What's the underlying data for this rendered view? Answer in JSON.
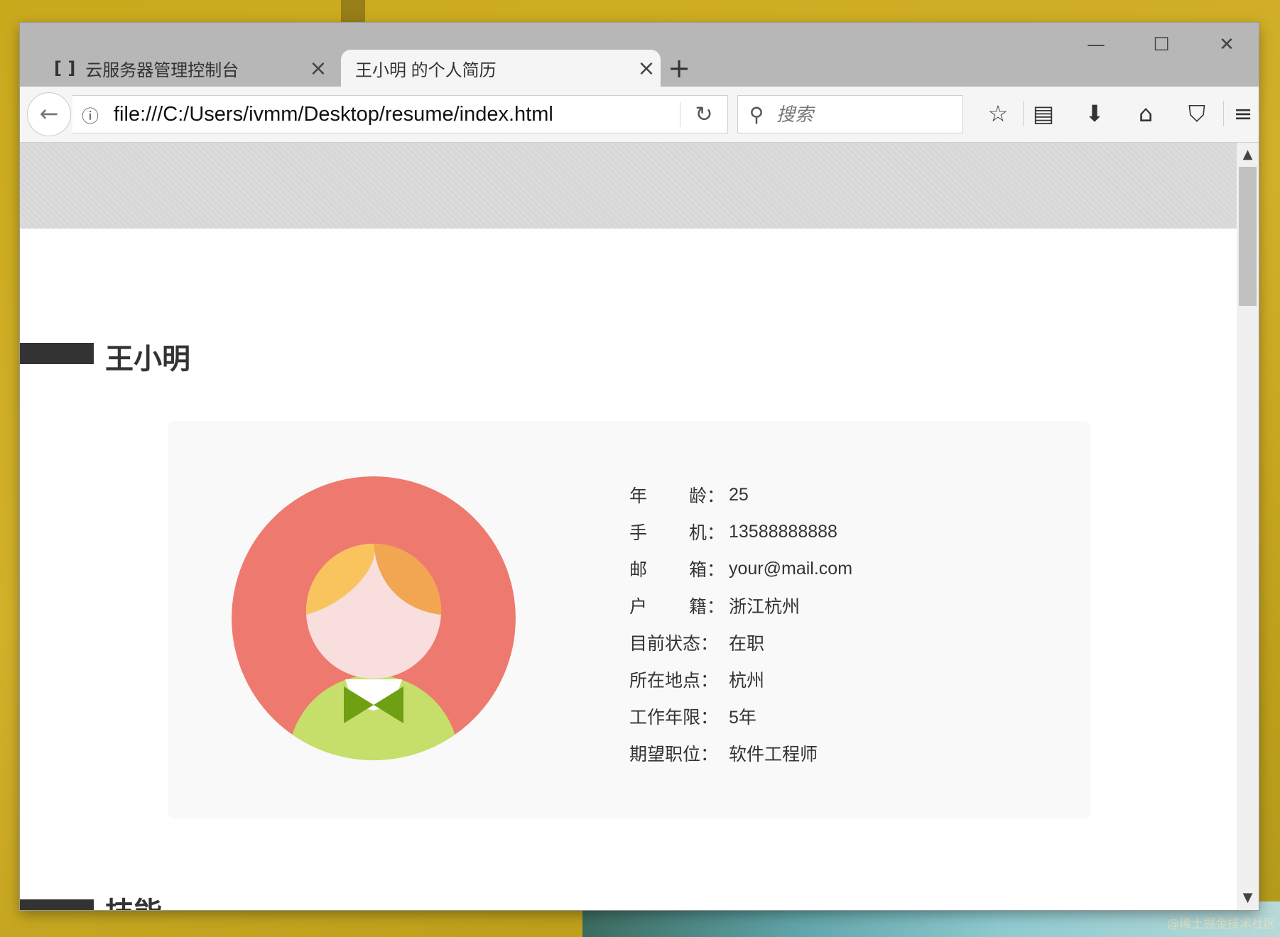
{
  "tabs": [
    {
      "icon": "cloud-console-icon",
      "icon_glyph": "[ ]",
      "title": "云服务器管理控制台",
      "close": "×"
    },
    {
      "title": "王小明 的个人简历",
      "close": "×"
    }
  ],
  "new_tab": "+",
  "window_controls": {
    "minimize": "—",
    "maximize": "☐",
    "close": "✕"
  },
  "toolbar": {
    "back": "←",
    "info": "ⓘ",
    "url": "file:///C:/Users/ivmm/Desktop/resume/index.html",
    "reload": "↻",
    "search_placeholder": "搜索",
    "search_glyph": "⚲",
    "bookmark": "☆",
    "reading_list": "▤",
    "download": "⬇",
    "home": "⌂",
    "pocket": "⛉",
    "menu": "≡"
  },
  "resume": {
    "name": "王小明",
    "next_section": "技能",
    "info": [
      {
        "label": [
          "年",
          "龄："
        ],
        "value": "25"
      },
      {
        "label": [
          "手",
          "机："
        ],
        "value": "13588888888"
      },
      {
        "label": [
          "邮",
          "箱："
        ],
        "value": "your@mail.com"
      },
      {
        "label": [
          "户",
          "籍："
        ],
        "value": "浙江杭州"
      },
      {
        "label": [
          "目前状态："
        ],
        "value": "在职"
      },
      {
        "label": [
          "所在地点："
        ],
        "value": "杭州"
      },
      {
        "label": [
          "工作年限："
        ],
        "value": "5年"
      },
      {
        "label": [
          "期望职位："
        ],
        "value": "软件工程师"
      }
    ]
  },
  "colors": {
    "avatar_bg": "#ee7a6f",
    "face": "#f9dede",
    "hair": "#f9c35d",
    "hair_shade": "#f2a652",
    "shirt": "#c6df6b",
    "bowtie": "#6fa013"
  },
  "scrollbar": {
    "up": "▲",
    "down": "▼"
  },
  "watermark": "@稀土掘金技术社区"
}
